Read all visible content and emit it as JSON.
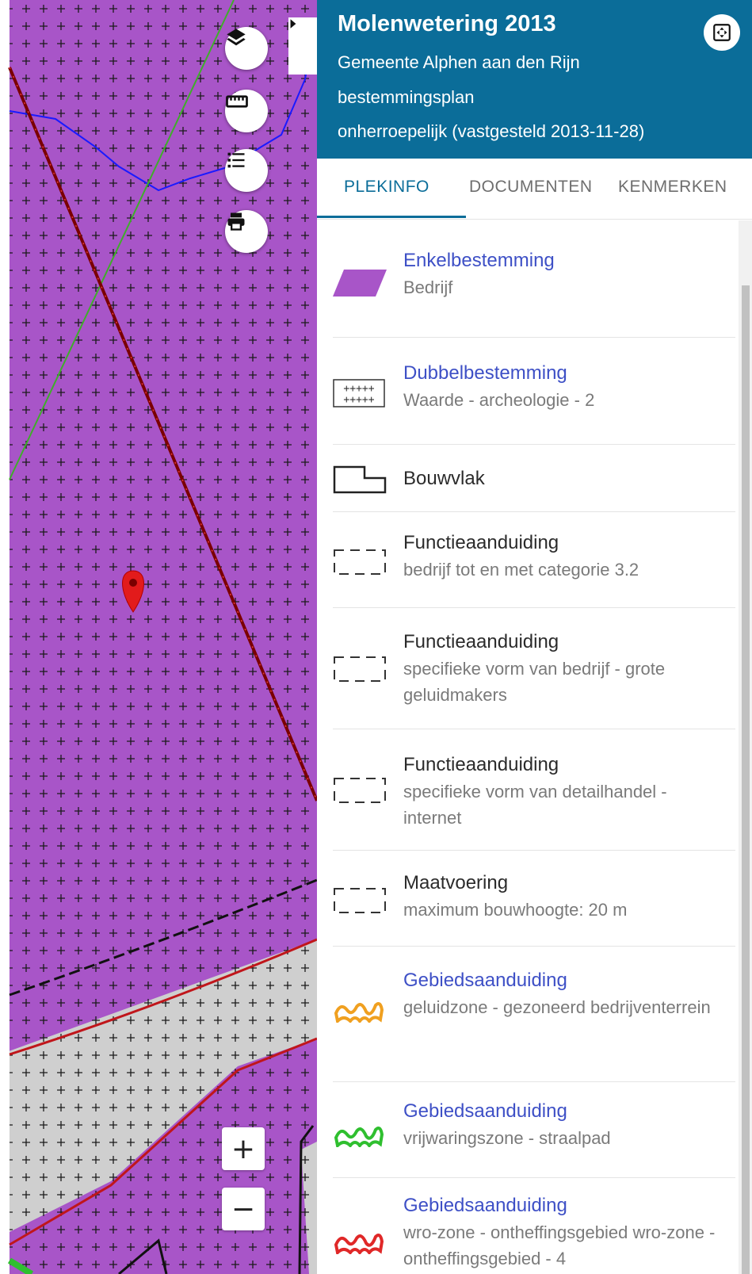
{
  "map": {
    "controls": {
      "layers_icon": "layers-icon",
      "measure_icon": "ruler-icon",
      "legend_icon": "list-icon",
      "print_icon": "printer-icon",
      "collapse_icon": "chevron-right-icon",
      "zoom_in_label": "+",
      "zoom_out_label": "−"
    },
    "colors": {
      "bedrijf": "#a855c8",
      "gray_area": "#cfcfcf",
      "marker": "#e21b1b"
    }
  },
  "panel": {
    "header": {
      "title": "Molenwetering 2013",
      "municipality": "Gemeente Alphen aan den Rijn",
      "plan_type": "bestemmingsplan",
      "status": "onherroepelijk (vastgesteld 2013-11-28)",
      "background": "#0b6d99"
    },
    "tabs": [
      {
        "label": "PLEKINFO",
        "active": true
      },
      {
        "label": "DOCUMENTEN",
        "active": false
      },
      {
        "label": "KENMERKEN",
        "active": false
      }
    ],
    "items": [
      {
        "title": "Enkelbestemming",
        "subtitle": "Bedrijf",
        "icon": "purple-area-icon",
        "link": true
      },
      {
        "title": "Dubbelbestemming",
        "subtitle": "Waarde - archeologie - 2",
        "icon": "hatched-area-icon",
        "link": true
      },
      {
        "title": "Bouwvlak",
        "subtitle": "",
        "icon": "building-outline-icon",
        "link": false
      },
      {
        "title": "Functieaanduiding",
        "subtitle": "bedrijf tot en met categorie 3.2",
        "icon": "dashed-box-icon",
        "link": false
      },
      {
        "title": "Functieaanduiding",
        "subtitle": "specifieke vorm van bedrijf - grote geluidmakers",
        "icon": "dashed-box-icon",
        "link": false
      },
      {
        "title": "Functieaanduiding",
        "subtitle": "specifieke vorm van detailhandel - internet",
        "icon": "dashed-box-icon",
        "link": false
      },
      {
        "title": "Maatvoering",
        "subtitle": "maximum bouwhoogte: 20 m",
        "icon": "dashed-box-icon",
        "link": false
      },
      {
        "title": "Gebiedsaanduiding",
        "subtitle": "geluidzone - gezoneerd bedrijventerrein",
        "icon": "orange-zone-icon",
        "link": true
      },
      {
        "title": "Gebiedsaanduiding",
        "subtitle": "vrijwaringszone - straalpad",
        "icon": "green-zone-icon",
        "link": true
      },
      {
        "title": "Gebiedsaanduiding",
        "subtitle": "wro-zone - ontheffingsgebied wro-zone - ontheffingsgebied - 4",
        "icon": "red-zone-icon",
        "link": true
      }
    ]
  }
}
